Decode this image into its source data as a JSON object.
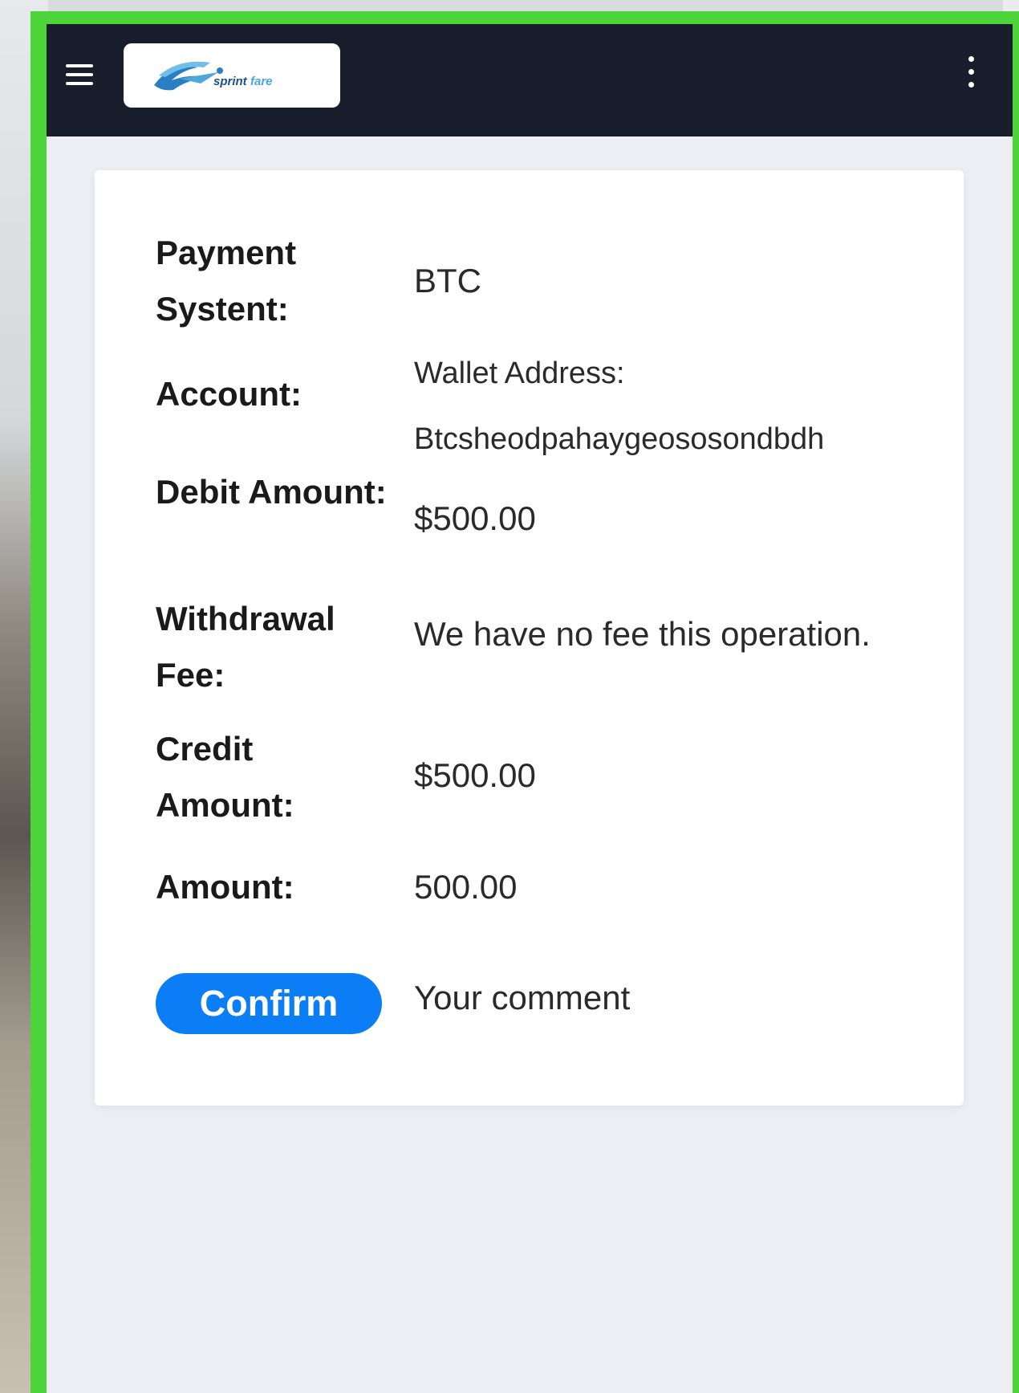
{
  "header": {
    "logo_text": "sprintfare",
    "accent_color": "#171d2a"
  },
  "details": {
    "payment_system_label": "Payment Systent:",
    "payment_system_value": "BTC",
    "account_label": "Account:",
    "account_value_line1": "Wallet Address:",
    "account_value_line2": "Btcsheodpahaygeososondbdh",
    "debit_label": "Debit Amount:",
    "debit_value": "$500.00",
    "fee_label": "Withdrawal Fee:",
    "fee_value": "We have no fee this operation.",
    "credit_label": "Credit Amount:",
    "credit_value": "$500.00",
    "amount_label": "Amount:",
    "amount_value": "500.00"
  },
  "actions": {
    "confirm_label": "Confirm",
    "comment_placeholder": "Your comment",
    "confirm_color": "#0b7df5"
  }
}
